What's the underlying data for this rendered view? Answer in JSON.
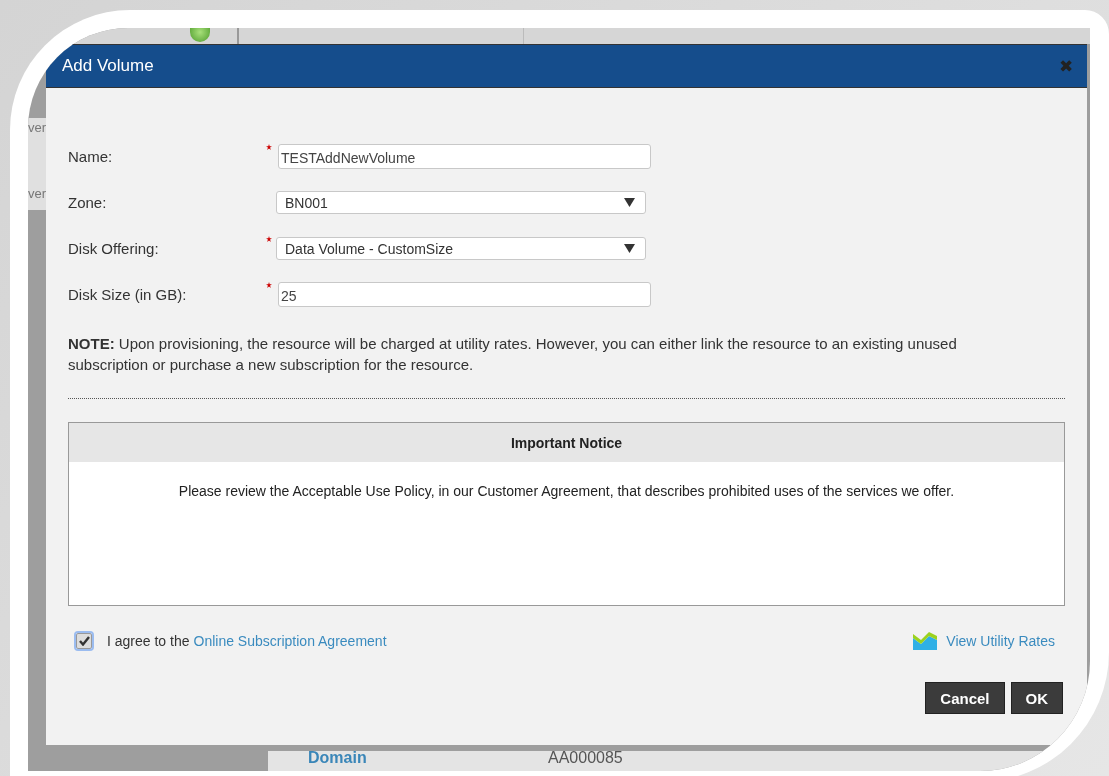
{
  "background": {
    "side_texts": [
      "ver",
      "ver"
    ],
    "bottom_row": [
      "Domain",
      "AA000085"
    ]
  },
  "dialog": {
    "title": "Add Volume",
    "close": "✖",
    "fields": [
      {
        "label": "Name:",
        "kind": "text",
        "required": true,
        "value": "TESTAddNewVolume"
      },
      {
        "label": "Zone:",
        "kind": "select",
        "required": false,
        "value": "BN001"
      },
      {
        "label": "Disk Offering:",
        "kind": "select",
        "required": true,
        "value": "Data Volume - CustomSize"
      },
      {
        "label": "Disk Size (in GB):",
        "kind": "text",
        "required": true,
        "value": "25"
      }
    ],
    "note": "**NOTE:** Upon provisioning, the resource will be charged at utility rates.  However, you can either link the resource to an existing unused subscription or purchase a new subscription for the resource.",
    "notice": {
      "title": "Important Notice",
      "text": "Please review the Acceptable Use Policy, in our Customer Agreement, that describes prohibited uses of the services we offer."
    },
    "agree": {
      "checked": true,
      "text": "I agree to the",
      "link": "Online Subscription Agreement"
    },
    "rates_link": "View Utility Rates",
    "buttons": [
      "Cancel",
      "OK"
    ]
  }
}
